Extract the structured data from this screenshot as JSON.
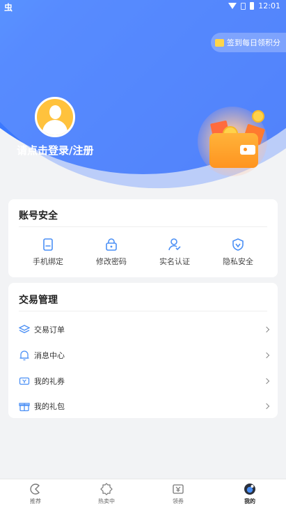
{
  "status_bar": {
    "app_icon": "虫",
    "time": "12:01"
  },
  "header": {
    "checkin_label": "签到每日领积分",
    "login_label": "请点击登录/注册"
  },
  "account_security": {
    "title": "账号安全",
    "items": [
      {
        "label": "手机绑定",
        "icon": "phone-icon"
      },
      {
        "label": "修改密码",
        "icon": "lock-icon"
      },
      {
        "label": "实名认证",
        "icon": "user-verify-icon"
      },
      {
        "label": "隐私安全",
        "icon": "shield-icon"
      }
    ]
  },
  "trade_management": {
    "title": "交易管理",
    "items": [
      {
        "label": "交易订单",
        "icon": "layers-icon"
      },
      {
        "label": "消息中心",
        "icon": "bell-icon"
      },
      {
        "label": "我的礼券",
        "icon": "coupon-icon"
      },
      {
        "label": "我的礼包",
        "icon": "gift-icon"
      }
    ]
  },
  "bottom_nav": {
    "items": [
      {
        "label": "推荐",
        "icon": "recommend-icon"
      },
      {
        "label": "热卖中",
        "icon": "hot-icon"
      },
      {
        "label": "领券",
        "icon": "coupon-icon"
      },
      {
        "label": "我的",
        "icon": "profile-icon",
        "active": true
      }
    ]
  },
  "colors": {
    "accent": "#3d7bff",
    "icon_blue": "#4a8ff5",
    "coin": "#ffd24a"
  }
}
